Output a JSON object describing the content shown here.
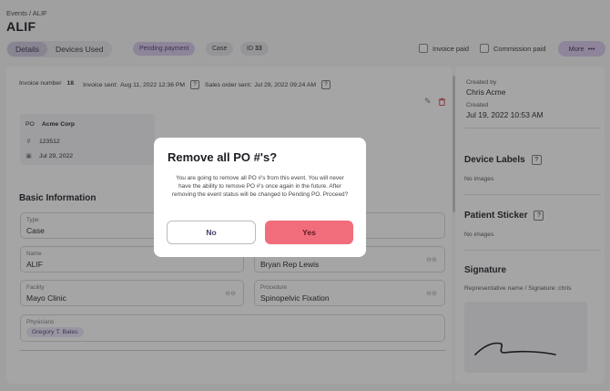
{
  "breadcrumb": {
    "parent": "Events",
    "separator": "/",
    "current": "ALIF"
  },
  "page_title": "ALIF",
  "tabs": [
    {
      "label": "Details",
      "active": true
    },
    {
      "label": "Devices Used",
      "active": false
    }
  ],
  "chips": {
    "status": "Pending payment",
    "type": "Case",
    "id_label": "ID",
    "id_value": "33"
  },
  "checkboxes": {
    "invoice_paid": "Invoice paid",
    "commission_paid": "Commission paid"
  },
  "more_button": {
    "label": "More",
    "icon": "ellipsis-icon"
  },
  "invoice": {
    "number_label": "Invoice number",
    "number_value": "18",
    "sent_label": "Invoice sent:",
    "sent_value": "Aug 11, 2022 12:36 PM",
    "sales_label": "Sales order sent:",
    "sales_value": "Jul 29, 2022 09:24 AM"
  },
  "po": {
    "label": "PO",
    "company": "Acme Corp",
    "number": "123512",
    "date": "Jul 29, 2022"
  },
  "basic_info": {
    "title": "Basic Information",
    "type_label": "Type",
    "type_value": "Case",
    "name_label": "Name",
    "name_value": "ALIF",
    "rep_value": "Bryan Rep Lewis",
    "facility_label": "Facility",
    "facility_value": "Mayo Clinic",
    "procedure_label": "Procedure",
    "procedure_value": "Spinopelvic Fixation",
    "physicians_label": "Physicians",
    "physician": "Gregory T. Bales"
  },
  "side": {
    "created_by_label": "Created by",
    "created_by_value": "Chris Acme",
    "created_label": "Created",
    "created_value": "Jul 19, 2022 10:53 AM",
    "device_labels_title": "Device Labels",
    "device_labels_empty": "No images",
    "patient_sticker_title": "Patient Sticker",
    "patient_sticker_empty": "No images",
    "signature_title": "Signature",
    "signature_caption": "Representative name / Signature: chris"
  },
  "modal": {
    "title": "Remove all PO #'s?",
    "body": "You are going to remove all PO #'s from this event. You will never have the ability to remove PO #'s once again in the future. After removing the event status will be changed to Pending PO. Proceed?",
    "no_label": "No",
    "yes_label": "Yes"
  },
  "colors": {
    "accent": "#d8c9ec",
    "danger": "#f26d7b",
    "overlay": "#28282c"
  }
}
